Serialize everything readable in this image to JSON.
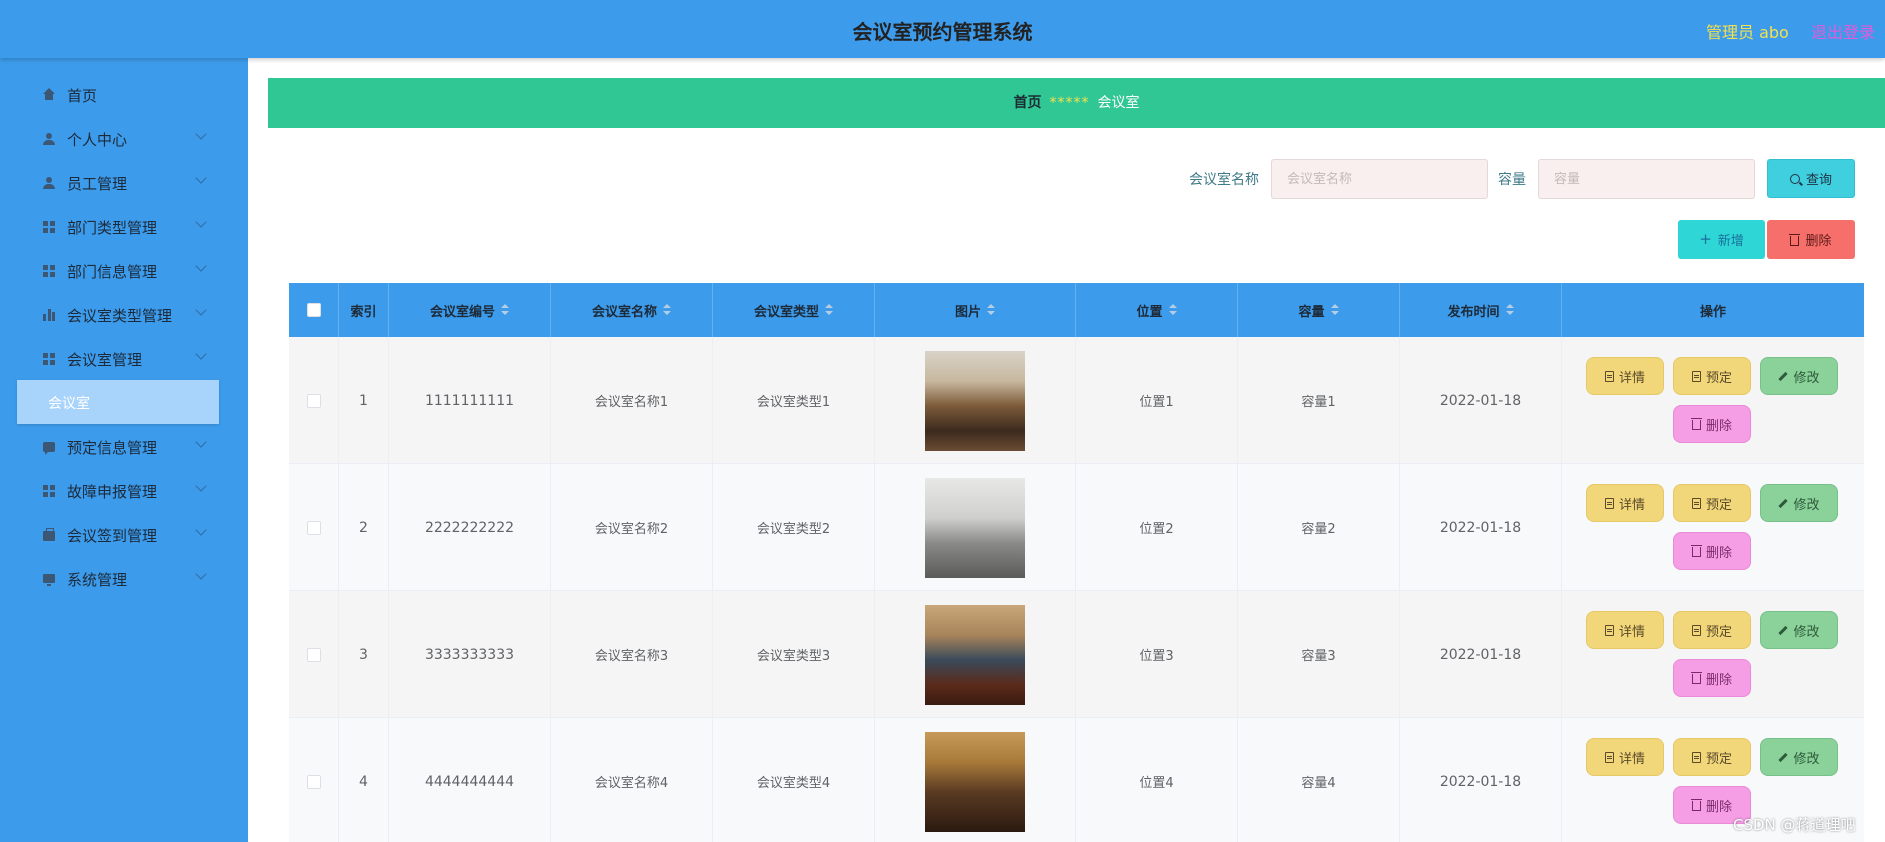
{
  "header": {
    "title": "会议室预约管理系统",
    "admin_label": "管理员 abo",
    "logout_label": "退出登录"
  },
  "sidebar": {
    "items": [
      {
        "label": "首页",
        "icon": "home-icon"
      },
      {
        "label": "个人中心",
        "icon": "user-icon"
      },
      {
        "label": "员工管理",
        "icon": "user-icon"
      },
      {
        "label": "部门类型管理",
        "icon": "grid-icon"
      },
      {
        "label": "部门信息管理",
        "icon": "grid-icon"
      },
      {
        "label": "会议室类型管理",
        "icon": "bar-chart-icon"
      },
      {
        "label": "会议室管理",
        "icon": "grid-icon"
      },
      {
        "label": "预定信息管理",
        "icon": "chat-icon"
      },
      {
        "label": "故障申报管理",
        "icon": "grid-icon"
      },
      {
        "label": "会议签到管理",
        "icon": "bag-icon"
      },
      {
        "label": "系统管理",
        "icon": "monitor-icon"
      }
    ],
    "active_sub": "会议室"
  },
  "breadcrumb": {
    "home": "首页",
    "separator": "*****",
    "current": "会议室"
  },
  "search": {
    "name_label": "会议室名称",
    "name_placeholder": "会议室名称",
    "capacity_label": "容量",
    "capacity_placeholder": "容量",
    "query_label": "查询"
  },
  "actions": {
    "add_label": "新增",
    "delete_label": "删除"
  },
  "table": {
    "columns": [
      "索引",
      "会议室编号",
      "会议室名称",
      "会议室类型",
      "图片",
      "位置",
      "容量",
      "发布时间",
      "操作"
    ],
    "rows": [
      {
        "index": "1",
        "code": "1111111111",
        "name": "会议室名称1",
        "type": "会议室类型1",
        "location": "位置1",
        "capacity": "容量1",
        "time": "2022-01-18"
      },
      {
        "index": "2",
        "code": "2222222222",
        "name": "会议室名称2",
        "type": "会议室类型2",
        "location": "位置2",
        "capacity": "容量2",
        "time": "2022-01-18"
      },
      {
        "index": "3",
        "code": "3333333333",
        "name": "会议室名称3",
        "type": "会议室类型3",
        "location": "位置3",
        "capacity": "容量3",
        "time": "2022-01-18"
      },
      {
        "index": "4",
        "code": "4444444444",
        "name": "会议室名称4",
        "type": "会议室类型4",
        "location": "位置4",
        "capacity": "容量4",
        "time": "2022-01-18"
      }
    ],
    "op_labels": {
      "detail": "详情",
      "book": "预定",
      "edit": "修改",
      "delete": "删除"
    }
  },
  "watermark": "CSDN @蒋道理吧",
  "colors": {
    "primary": "#3d9beb",
    "breadcrumb_bg": "#31c794",
    "detail_btn": "#f2d77a",
    "edit_btn": "#8ad19a",
    "delete_btn": "#f59ee6",
    "delete_top": "#f66f6a",
    "add_btn": "#2ed6d6"
  }
}
